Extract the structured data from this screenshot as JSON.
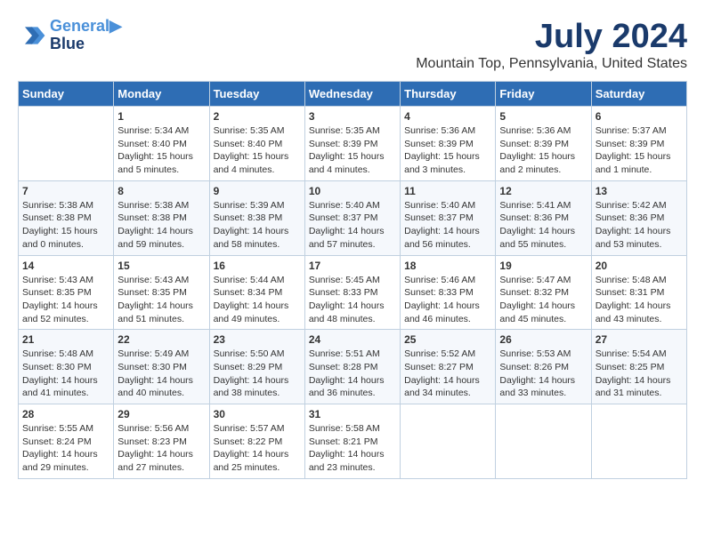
{
  "header": {
    "logo_line1": "General",
    "logo_line2": "Blue",
    "title": "July 2024",
    "subtitle": "Mountain Top, Pennsylvania, United States"
  },
  "calendar": {
    "days_of_week": [
      "Sunday",
      "Monday",
      "Tuesday",
      "Wednesday",
      "Thursday",
      "Friday",
      "Saturday"
    ],
    "weeks": [
      [
        {
          "day": "",
          "info": ""
        },
        {
          "day": "1",
          "info": "Sunrise: 5:34 AM\nSunset: 8:40 PM\nDaylight: 15 hours\nand 5 minutes."
        },
        {
          "day": "2",
          "info": "Sunrise: 5:35 AM\nSunset: 8:40 PM\nDaylight: 15 hours\nand 4 minutes."
        },
        {
          "day": "3",
          "info": "Sunrise: 5:35 AM\nSunset: 8:39 PM\nDaylight: 15 hours\nand 4 minutes."
        },
        {
          "day": "4",
          "info": "Sunrise: 5:36 AM\nSunset: 8:39 PM\nDaylight: 15 hours\nand 3 minutes."
        },
        {
          "day": "5",
          "info": "Sunrise: 5:36 AM\nSunset: 8:39 PM\nDaylight: 15 hours\nand 2 minutes."
        },
        {
          "day": "6",
          "info": "Sunrise: 5:37 AM\nSunset: 8:39 PM\nDaylight: 15 hours\nand 1 minute."
        }
      ],
      [
        {
          "day": "7",
          "info": "Sunrise: 5:38 AM\nSunset: 8:38 PM\nDaylight: 15 hours\nand 0 minutes."
        },
        {
          "day": "8",
          "info": "Sunrise: 5:38 AM\nSunset: 8:38 PM\nDaylight: 14 hours\nand 59 minutes."
        },
        {
          "day": "9",
          "info": "Sunrise: 5:39 AM\nSunset: 8:38 PM\nDaylight: 14 hours\nand 58 minutes."
        },
        {
          "day": "10",
          "info": "Sunrise: 5:40 AM\nSunset: 8:37 PM\nDaylight: 14 hours\nand 57 minutes."
        },
        {
          "day": "11",
          "info": "Sunrise: 5:40 AM\nSunset: 8:37 PM\nDaylight: 14 hours\nand 56 minutes."
        },
        {
          "day": "12",
          "info": "Sunrise: 5:41 AM\nSunset: 8:36 PM\nDaylight: 14 hours\nand 55 minutes."
        },
        {
          "day": "13",
          "info": "Sunrise: 5:42 AM\nSunset: 8:36 PM\nDaylight: 14 hours\nand 53 minutes."
        }
      ],
      [
        {
          "day": "14",
          "info": "Sunrise: 5:43 AM\nSunset: 8:35 PM\nDaylight: 14 hours\nand 52 minutes."
        },
        {
          "day": "15",
          "info": "Sunrise: 5:43 AM\nSunset: 8:35 PM\nDaylight: 14 hours\nand 51 minutes."
        },
        {
          "day": "16",
          "info": "Sunrise: 5:44 AM\nSunset: 8:34 PM\nDaylight: 14 hours\nand 49 minutes."
        },
        {
          "day": "17",
          "info": "Sunrise: 5:45 AM\nSunset: 8:33 PM\nDaylight: 14 hours\nand 48 minutes."
        },
        {
          "day": "18",
          "info": "Sunrise: 5:46 AM\nSunset: 8:33 PM\nDaylight: 14 hours\nand 46 minutes."
        },
        {
          "day": "19",
          "info": "Sunrise: 5:47 AM\nSunset: 8:32 PM\nDaylight: 14 hours\nand 45 minutes."
        },
        {
          "day": "20",
          "info": "Sunrise: 5:48 AM\nSunset: 8:31 PM\nDaylight: 14 hours\nand 43 minutes."
        }
      ],
      [
        {
          "day": "21",
          "info": "Sunrise: 5:48 AM\nSunset: 8:30 PM\nDaylight: 14 hours\nand 41 minutes."
        },
        {
          "day": "22",
          "info": "Sunrise: 5:49 AM\nSunset: 8:30 PM\nDaylight: 14 hours\nand 40 minutes."
        },
        {
          "day": "23",
          "info": "Sunrise: 5:50 AM\nSunset: 8:29 PM\nDaylight: 14 hours\nand 38 minutes."
        },
        {
          "day": "24",
          "info": "Sunrise: 5:51 AM\nSunset: 8:28 PM\nDaylight: 14 hours\nand 36 minutes."
        },
        {
          "day": "25",
          "info": "Sunrise: 5:52 AM\nSunset: 8:27 PM\nDaylight: 14 hours\nand 34 minutes."
        },
        {
          "day": "26",
          "info": "Sunrise: 5:53 AM\nSunset: 8:26 PM\nDaylight: 14 hours\nand 33 minutes."
        },
        {
          "day": "27",
          "info": "Sunrise: 5:54 AM\nSunset: 8:25 PM\nDaylight: 14 hours\nand 31 minutes."
        }
      ],
      [
        {
          "day": "28",
          "info": "Sunrise: 5:55 AM\nSunset: 8:24 PM\nDaylight: 14 hours\nand 29 minutes."
        },
        {
          "day": "29",
          "info": "Sunrise: 5:56 AM\nSunset: 8:23 PM\nDaylight: 14 hours\nand 27 minutes."
        },
        {
          "day": "30",
          "info": "Sunrise: 5:57 AM\nSunset: 8:22 PM\nDaylight: 14 hours\nand 25 minutes."
        },
        {
          "day": "31",
          "info": "Sunrise: 5:58 AM\nSunset: 8:21 PM\nDaylight: 14 hours\nand 23 minutes."
        },
        {
          "day": "",
          "info": ""
        },
        {
          "day": "",
          "info": ""
        },
        {
          "day": "",
          "info": ""
        }
      ]
    ]
  }
}
